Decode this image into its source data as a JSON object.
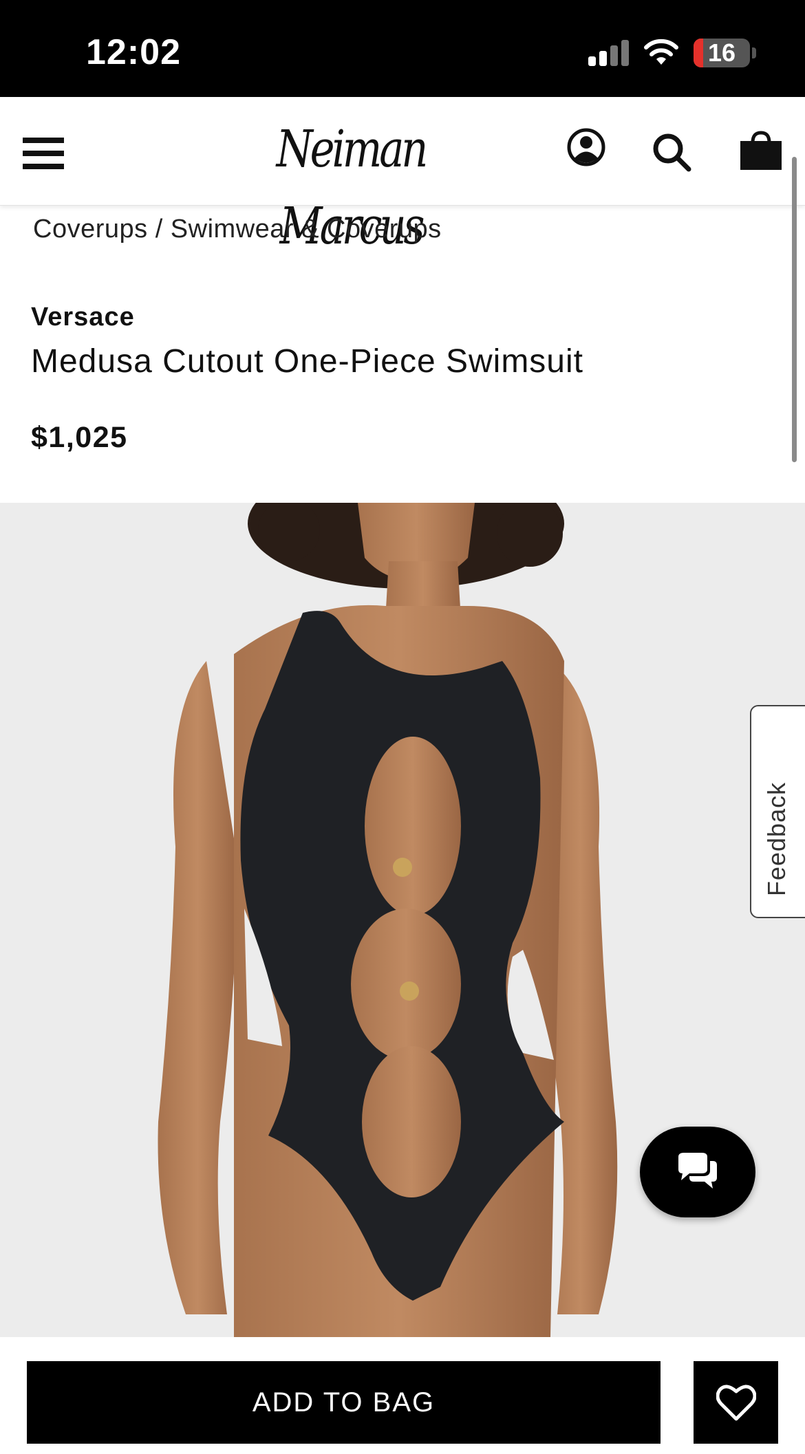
{
  "status_bar": {
    "time": "12:02",
    "battery_level": "16",
    "icons": [
      "cellular-signal-icon",
      "wifi-icon",
      "battery-icon"
    ]
  },
  "header": {
    "logo_text": "Neiman Marcus",
    "icons": [
      "hamburger-menu-icon",
      "account-icon",
      "search-icon",
      "shopping-bag-icon"
    ]
  },
  "breadcrumb": {
    "text": "Coverups / Swimwear & Coverups"
  },
  "product": {
    "brand": "Versace",
    "name": "Medusa Cutout One-Piece Swimsuit",
    "price": "$1,025"
  },
  "feedback": {
    "label": "Feedback"
  },
  "actions": {
    "add_to_bag_label": "ADD TO BAG",
    "icons": [
      "chat-icon",
      "heart-icon"
    ]
  },
  "colors": {
    "primary": "#000000",
    "background": "#ffffff",
    "image_background": "#ebebeb",
    "battery_low": "#e5312b"
  }
}
